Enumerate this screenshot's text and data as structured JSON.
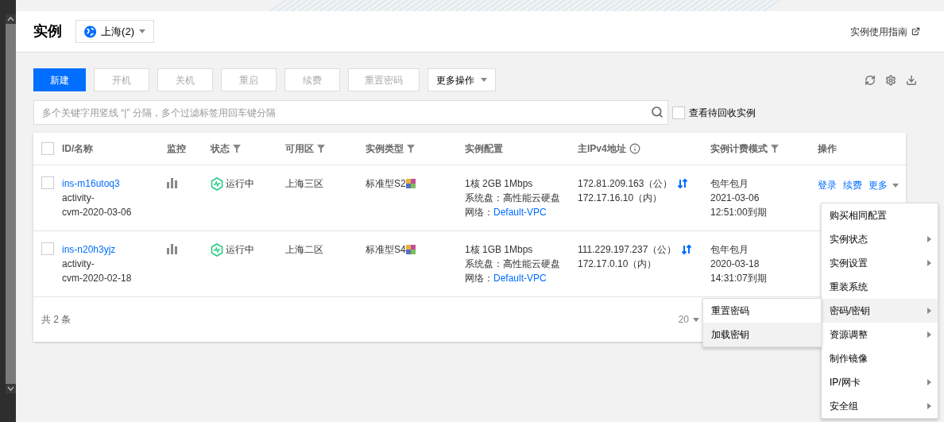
{
  "header": {
    "title": "实例",
    "region": "上海(2)",
    "guide_link": "实例使用指南"
  },
  "toolbar": {
    "buttons": [
      {
        "label": "新建",
        "kind": "primary"
      },
      {
        "label": "开机",
        "kind": "plain",
        "disabled": true
      },
      {
        "label": "关机",
        "kind": "plain",
        "disabled": true
      },
      {
        "label": "重启",
        "kind": "plain",
        "disabled": true
      },
      {
        "label": "续费",
        "kind": "plain",
        "disabled": true
      },
      {
        "label": "重置密码",
        "kind": "plain",
        "disabled": true
      },
      {
        "label": "更多操作",
        "kind": "dropdown"
      }
    ]
  },
  "search": {
    "placeholder": "多个关键字用竖线 “|” 分隔，多个过滤标签用回车键分隔",
    "recycle_checkbox": {
      "label": "查看待回收实例",
      "checked": false
    }
  },
  "table": {
    "select_all_checked": false,
    "columns": [
      {
        "label": "ID/名称",
        "kind": "plain"
      },
      {
        "label": "监控",
        "kind": "plain"
      },
      {
        "label": "状态",
        "kind": "filter"
      },
      {
        "label": "可用区",
        "kind": "filter"
      },
      {
        "label": "实例类型",
        "kind": "filter"
      },
      {
        "label": "实例配置",
        "kind": "plain"
      },
      {
        "label": "主IPv4地址",
        "kind": "info"
      },
      {
        "label": "实例计费模式",
        "kind": "filter"
      },
      {
        "label": "操作",
        "kind": "plain"
      }
    ],
    "rows": [
      {
        "checked": false,
        "id": "ins-m16utoq3",
        "name": [
          "activity-",
          "cvm-2020-03-06"
        ],
        "status": "运行中",
        "zone": "上海三区",
        "type": "标准型S2",
        "config": "1核 2GB 1Mbps",
        "disk": "系统盘：高性能云硬盘",
        "network_label": "网络：",
        "network": "Default-VPC",
        "public_ip": "172.81.209.163（公）",
        "private_ip": "172.17.16.10（内）",
        "billing": [
          "包年包月",
          "2021-03-06",
          "12:51:00到期"
        ],
        "actions": [
          "登录",
          "续费",
          "更多"
        ]
      },
      {
        "checked": false,
        "id": "ins-n20h3yjz",
        "name": [
          "activity-",
          "cvm-2020-02-18"
        ],
        "status": "运行中",
        "zone": "上海二区",
        "type": "标准型S4",
        "config": "1核 1GB 1Mbps",
        "disk": "系统盘：高性能云硬盘",
        "network_label": "网络：",
        "network": "Default-VPC",
        "public_ip": "111.229.197.237（公）",
        "private_ip": "172.17.0.10（内）",
        "billing": [
          "包年包月",
          "2020-03-18",
          "14:31:07到期"
        ],
        "actions": []
      }
    ],
    "footer": {
      "total": "共 2 条",
      "page_size": "20"
    }
  },
  "context_menu": {
    "items": [
      {
        "label": "购买相同配置",
        "has_submenu": false,
        "selected": false
      },
      {
        "label": "实例状态",
        "has_submenu": true,
        "selected": false
      },
      {
        "label": "实例设置",
        "has_submenu": true,
        "selected": false
      },
      {
        "label": "重装系统",
        "has_submenu": false,
        "selected": false
      },
      {
        "label": "密码/密钥",
        "has_submenu": true,
        "selected": true
      },
      {
        "label": "资源调整",
        "has_submenu": true,
        "selected": false
      },
      {
        "label": "制作镜像",
        "has_submenu": false,
        "selected": false
      },
      {
        "label": "IP/网卡",
        "has_submenu": true,
        "selected": false
      },
      {
        "label": "安全组",
        "has_submenu": true,
        "selected": false
      }
    ]
  },
  "submenu": {
    "items": [
      {
        "label": "重置密码",
        "selected": false
      },
      {
        "label": "加载密钥",
        "selected": true
      }
    ]
  }
}
